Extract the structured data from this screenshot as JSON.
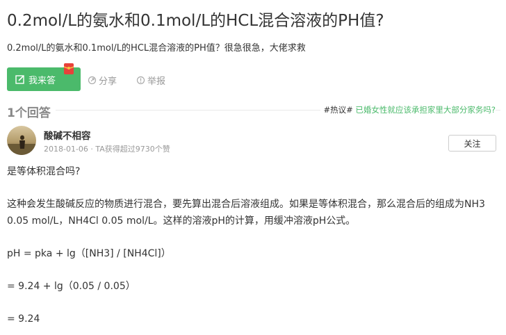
{
  "question": {
    "title": "0.2mol/L的氨水和0.1mol/L的HCL混合溶液的PH值?",
    "description": "0.2mol/L的氨水和0.1mol/L的HCL混合溶液的PH值？很急很急，大佬求救"
  },
  "actions": {
    "answer_label": "我来答",
    "share_label": "分享",
    "report_label": "举报"
  },
  "answers_section": {
    "count_label": "1个回答",
    "hot_tag": "#热议#",
    "hot_link": "已婚女性就应该承担家里大部分家务吗?"
  },
  "answer": {
    "author": "酸碱不相容",
    "meta": "2018-01-06 · TA获得超过9730个赞",
    "follow_label": "关注",
    "paragraphs": [
      "是等体积混合吗?",
      "这种会发生酸碱反应的物质进行混合，要先算出混合后溶液组成。如果是等体积混合，那么混合后的组成为NH3 0.05 mol/L，NH4Cl 0.05 mol/L。这样的溶液pH的计算，用缓冲溶液pH公式。",
      "pH = pka + lg（[NH3] / [NH4Cl]）",
      "= 9.24 + lg（0.05 / 0.05）",
      "= 9.24"
    ]
  },
  "colors": {
    "accent": "#4bba6b",
    "muted": "#999999",
    "text": "#333333"
  }
}
